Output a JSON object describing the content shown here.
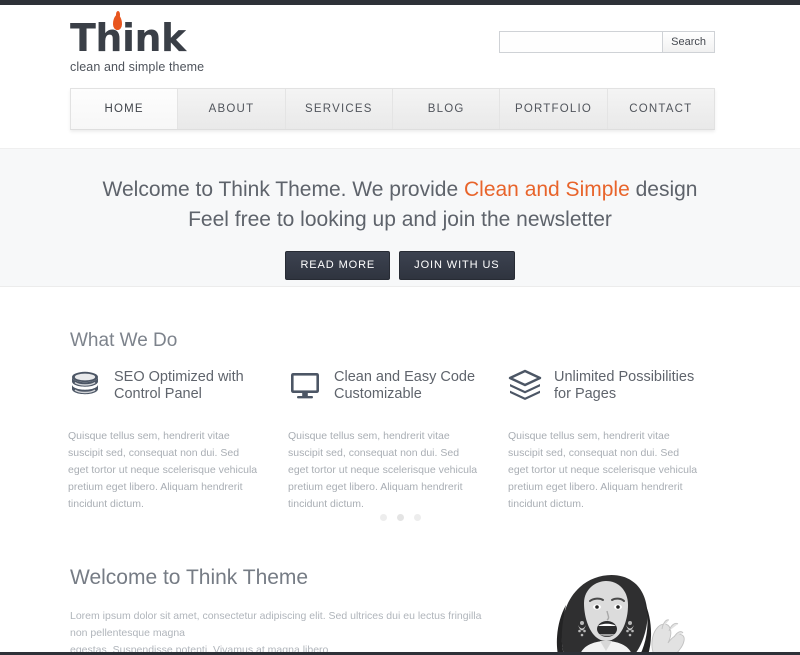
{
  "brand": {
    "name": "Think",
    "tagline": "clean and simple theme",
    "accent_color": "#e8561f"
  },
  "search": {
    "value": "",
    "placeholder": "",
    "button_label": "Search"
  },
  "nav": {
    "items": [
      {
        "label": "HOME",
        "active": true
      },
      {
        "label": "ABOUT",
        "active": false
      },
      {
        "label": "SERVICES",
        "active": false
      },
      {
        "label": "BLOG",
        "active": false
      },
      {
        "label": "PORTFOLIO",
        "active": false
      },
      {
        "label": "CONTACT",
        "active": false
      }
    ]
  },
  "hero": {
    "line1_before": "Welcome to Think Theme. We provide ",
    "line1_accent": "Clean and Simple",
    "line1_after": " design",
    "line2": "Feel free to looking up and join the newsletter",
    "accent_color": "#e8642b",
    "buttons": [
      {
        "label": "READ MORE"
      },
      {
        "label": "JOIN WITH US"
      }
    ]
  },
  "what_we_do": {
    "title": "What We Do",
    "icon_color": "#4c5665",
    "features": [
      {
        "icon": "database-icon",
        "title_line1": "SEO Optimized with",
        "title_line2": "Control Panel",
        "text": "Quisque tellus sem, hendrerit vitae suscipit sed, consequat non dui. Sed eget tortor ut neque scelerisque vehicula pretium eget libero. Aliquam hendrerit tincidunt dictum."
      },
      {
        "icon": "monitor-icon",
        "title_line1": "Clean and Easy Code",
        "title_line2": "Customizable",
        "text": "Quisque tellus sem, hendrerit vitae suscipit sed, consequat non dui. Sed eget tortor ut neque scelerisque vehicula pretium eget libero. Aliquam hendrerit tincidunt dictum."
      },
      {
        "icon": "layers-icon",
        "title_line1": "Unlimited Possibilities",
        "title_line2": "for Pages",
        "text": "Quisque tellus sem, hendrerit vitae suscipit sed, consequat non dui. Sed eget tortor ut neque scelerisque vehicula pretium eget libero. Aliquam hendrerit tincidunt dictum."
      }
    ],
    "carousel_dots": 3,
    "carousel_active_index": 1
  },
  "welcome": {
    "title": "Welcome to Think Theme",
    "paragraph_line1": "Lorem ipsum dolor sit amet, consectetur adipiscing elit. Sed ultrices dui eu lectus fringilla non pellentesque magna",
    "paragraph_line2": "egestas. Suspendisse potenti. Vivamus at magna libero.",
    "photo_alt": "smiling-woman-photo"
  }
}
